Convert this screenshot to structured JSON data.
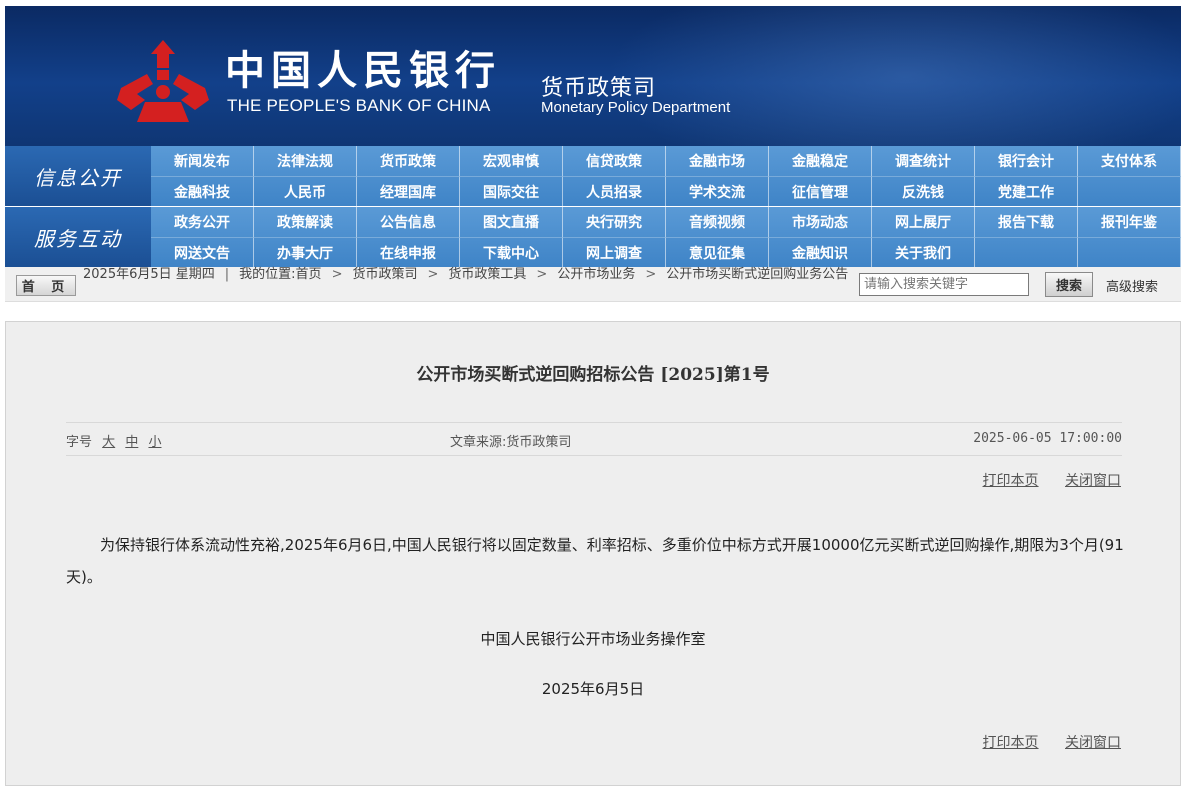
{
  "header": {
    "bank_name_cn": "中国人民银行",
    "bank_name_en": "THE PEOPLE'S BANK OF CHINA",
    "dept_cn": "货币政策司",
    "dept_en": "Monetary Policy Department",
    "logo_color": "#d42020"
  },
  "nav": {
    "section1_label": "信息公开",
    "section1_items": [
      "新闻发布",
      "法律法规",
      "货币政策",
      "宏观审慎",
      "信贷政策",
      "金融市场",
      "金融稳定",
      "调查统计",
      "银行会计",
      "支付体系",
      "金融科技",
      "人民币",
      "经理国库",
      "国际交往",
      "人员招录",
      "学术交流",
      "征信管理",
      "反洗钱",
      "党建工作",
      ""
    ],
    "section2_label": "服务互动",
    "section2_items": [
      "政务公开",
      "政策解读",
      "公告信息",
      "图文直播",
      "央行研究",
      "音频视频",
      "市场动态",
      "网上展厅",
      "报告下载",
      "报刊年鉴",
      "网送文告",
      "办事大厅",
      "在线申报",
      "下载中心",
      "网上调查",
      "意见征集",
      "金融知识",
      "关于我们",
      "",
      ""
    ]
  },
  "crumb": {
    "home": "首 页",
    "date": "2025年6月5日 星期四",
    "location_label": "我的位置:",
    "items": [
      "首页",
      "货币政策司",
      "货币政策工具",
      "公开市场业务",
      "公开市场买断式逆回购业务公告"
    ]
  },
  "search": {
    "placeholder": "请输入搜索关键字",
    "button": "搜索",
    "advanced": "高级搜索"
  },
  "article": {
    "title": "公开市场买断式逆回购招标公告 [2025]第1号",
    "font_size_label": "字号",
    "font_large": "大",
    "font_medium": "中",
    "font_small": "小",
    "source": "文章来源:货币政策司",
    "published": "2025-06-05 17:00:00",
    "print": "打印本页",
    "close": "关闭窗口",
    "body": "为保持银行体系流动性充裕,2025年6月6日,中国人民银行将以固定数量、利率招标、多重价位中标方式开展10000亿元买断式逆回购操作,期限为3个月(91天)。",
    "signoff": "中国人民银行公开市场业务操作室",
    "sign_date": "2025年6月5日"
  }
}
